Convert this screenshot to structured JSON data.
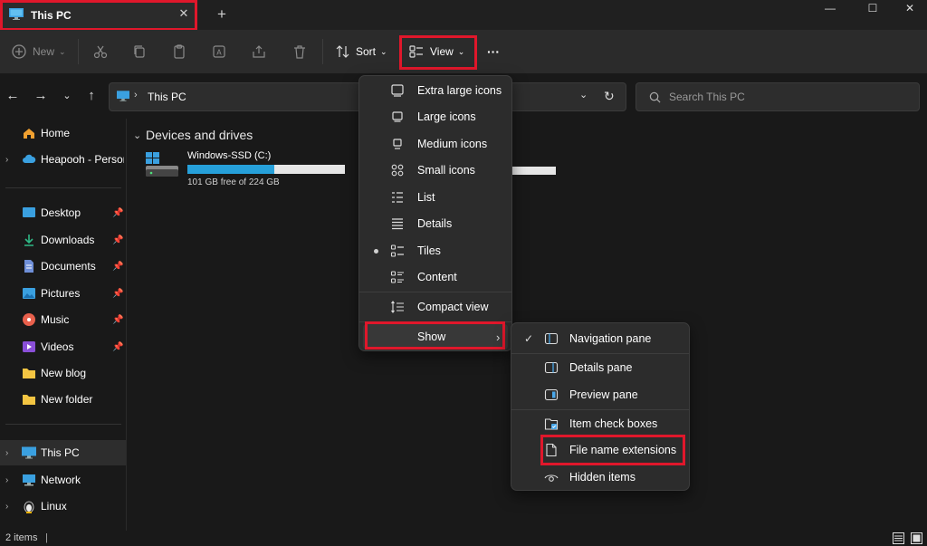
{
  "window": {
    "tab_title": "This PC",
    "new_tab": "+",
    "close_tab": "✕",
    "minimize": "—",
    "maximize": "☐",
    "close": "✕"
  },
  "toolbar": {
    "new_label": "New",
    "sort_label": "Sort",
    "view_label": "View",
    "more_label": "···"
  },
  "address": {
    "path": "This PC",
    "search_placeholder": "Search This PC"
  },
  "sidebar": {
    "items": [
      {
        "label": "Home"
      },
      {
        "label": "Heapooh - Personal"
      },
      {
        "label": "Desktop"
      },
      {
        "label": "Downloads"
      },
      {
        "label": "Documents"
      },
      {
        "label": "Pictures"
      },
      {
        "label": "Music"
      },
      {
        "label": "Videos"
      },
      {
        "label": "New blog"
      },
      {
        "label": "New folder"
      },
      {
        "label": "This PC"
      },
      {
        "label": "Network"
      },
      {
        "label": "Linux"
      }
    ]
  },
  "content": {
    "section_title": "Devices and drives",
    "drive": {
      "name": "Windows-SSD (C:)",
      "free_text": "101 GB free of 224 GB",
      "used_fraction": 0.549
    }
  },
  "status": {
    "items_count": "2 items"
  },
  "view_menu": {
    "items": [
      {
        "label": "Extra large icons"
      },
      {
        "label": "Large icons"
      },
      {
        "label": "Medium icons"
      },
      {
        "label": "Small icons"
      },
      {
        "label": "List"
      },
      {
        "label": "Details"
      },
      {
        "label": "Tiles",
        "selected": true
      },
      {
        "label": "Content"
      }
    ],
    "compact_label": "Compact view",
    "show_label": "Show"
  },
  "show_menu": {
    "items": [
      {
        "label": "Navigation pane",
        "checked": true
      },
      {
        "label": "Details pane",
        "checked": false
      },
      {
        "label": "Preview pane",
        "checked": false
      },
      {
        "label": "Item check boxes",
        "checked": false
      },
      {
        "label": "File name extensions",
        "checked": false
      },
      {
        "label": "Hidden items",
        "checked": false
      }
    ]
  },
  "colors": {
    "accent": "#26a0da",
    "highlight": "#e0172b",
    "background": "#191919"
  }
}
